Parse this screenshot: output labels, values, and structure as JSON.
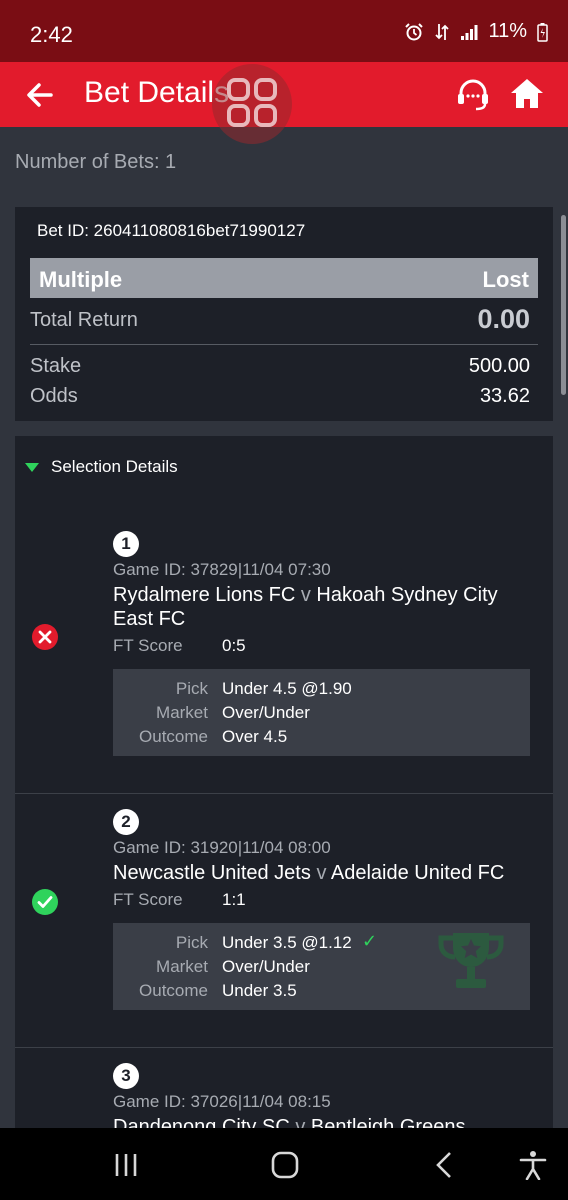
{
  "status_bar": {
    "time": "2:42",
    "battery": "11%"
  },
  "header": {
    "title": "Bet Details"
  },
  "summary": {
    "bets_count": "Number of Bets: 1"
  },
  "bet": {
    "id_label": "Bet ID: 260411080816bet71990127",
    "type": "Multiple",
    "status": "Lost",
    "total_return_label": "Total Return",
    "total_return": "0.00",
    "stake_label": "Stake",
    "stake": "500.00",
    "odds_label": "Odds",
    "odds": "33.62"
  },
  "selection_details": {
    "title": "Selection Details",
    "labels": {
      "ft_score": "FT Score",
      "pick": "Pick",
      "market": "Market",
      "outcome": "Outcome",
      "vs": "v"
    },
    "items": [
      {
        "num": "1",
        "game_id": "Game ID: 37829|11/04 07:30",
        "home": "Rydalmere Lions FC",
        "away": "Hakoah Sydney City East FC",
        "ft_score": "0:5",
        "pick": "Under 4.5 @1.90",
        "market": "Over/Under",
        "outcome": "Over 4.5",
        "result_icon": "lost-icon"
      },
      {
        "num": "2",
        "game_id": "Game ID: 31920|11/04 08:00",
        "home": "Newcastle United Jets",
        "away": "Adelaide United FC",
        "ft_score": "1:1",
        "pick": "Under 3.5 @1.12",
        "market": "Over/Under",
        "outcome": "Under 3.5",
        "result_icon": "won-icon"
      },
      {
        "num": "3",
        "game_id": "Game ID: 37026|11/04 08:15",
        "home": "Dandenong City SC",
        "away": "Bentleigh Greens"
      }
    ]
  },
  "colors": {
    "header": "#e21b2c",
    "status_bar": "#7a0d14",
    "background": "#30343d",
    "card": "#1d2028",
    "won": "#2fd35c",
    "lost": "#e21b2c"
  }
}
